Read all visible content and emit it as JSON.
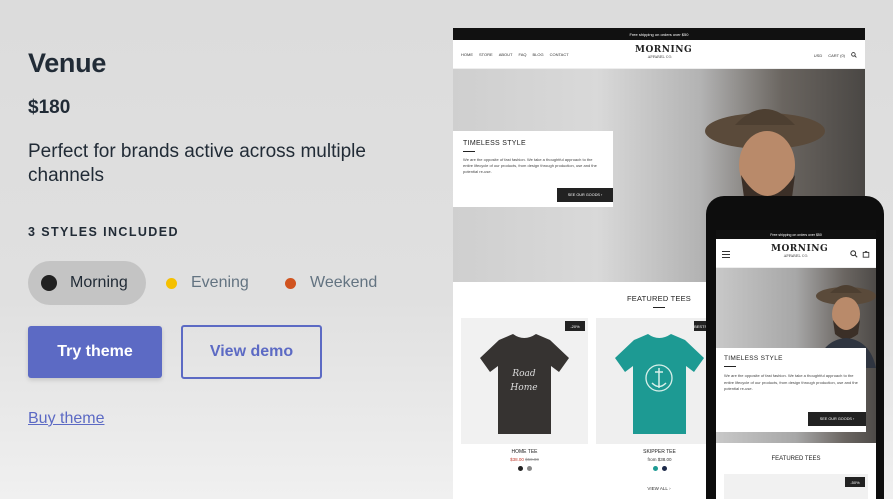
{
  "theme": {
    "name": "Venue",
    "price": "$180",
    "description": "Perfect for brands active across multiple channels",
    "styles_heading": "3 STYLES INCLUDED",
    "styles": [
      {
        "label": "Morning",
        "color": "#212121",
        "active": true
      },
      {
        "label": "Evening",
        "color": "#f5c000",
        "active": false
      },
      {
        "label": "Weekend",
        "color": "#d0531f",
        "active": false
      }
    ],
    "try_label": "Try theme",
    "demo_label": "View demo",
    "buy_label": "Buy theme"
  },
  "preview": {
    "announcement": "Free shipping on orders over $50",
    "nav_links": [
      "HOME",
      "STORE",
      "ABOUT",
      "FAQ",
      "BLOG",
      "CONTACT"
    ],
    "logo_main": "MORNING",
    "logo_sub": "APPAREL CO.",
    "currency": "USD",
    "cart": "CART (0)",
    "hero_title": "TIMELESS STYLE",
    "hero_text": "We are the opposite of fast fashion. We take a thoughtful approach to the entire lifecycle of our products, from design through production, use and the potential re-use.",
    "hero_button": "SEE OUR GOODS",
    "featured_heading": "FEATURED TEES",
    "products": [
      {
        "name": "HOME TEE",
        "price": "$38.00",
        "compare": "$50.00",
        "badge": "-20%"
      },
      {
        "name": "SKIPPER TEE",
        "price": "from $38.00",
        "badge": "BESTSELLER"
      }
    ],
    "view_all": "VIEW ALL",
    "mobile_badge": "-50%"
  },
  "colors": {
    "accent": "#5c6ac4",
    "text": "#212b36",
    "muted": "#637381"
  }
}
